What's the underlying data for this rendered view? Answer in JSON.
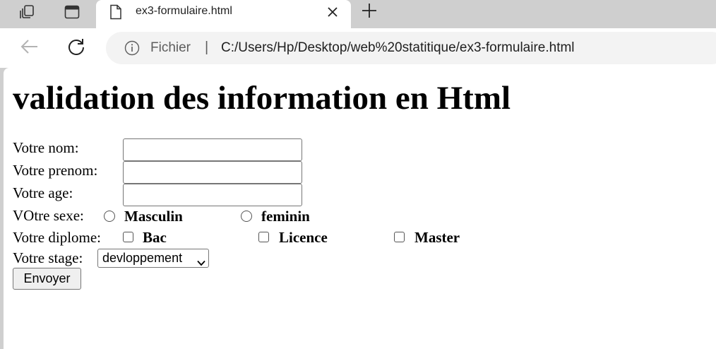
{
  "browser": {
    "tab_title": "ex3-formulaire.html",
    "scheme_label": "Fichier",
    "separator": "|",
    "url": "C:/Users/Hp/Desktop/web%20statitique/ex3-formulaire.html"
  },
  "page": {
    "heading": "validation des information en Html",
    "form": {
      "nom_label": "Votre nom:",
      "nom_value": "",
      "prenom_label": "Votre prenom:",
      "prenom_value": "",
      "age_label": "Votre age:",
      "age_value": "",
      "sexe_label": "VOtre sexe:",
      "sexe_options": [
        "Masculin",
        "feminin"
      ],
      "diplome_label": "Votre diplome:",
      "diplome_options": [
        "Bac",
        "Licence",
        "Master"
      ],
      "stage_label": "Votre stage:",
      "stage_selected": "devloppement",
      "submit_label": "Envoyer"
    }
  }
}
